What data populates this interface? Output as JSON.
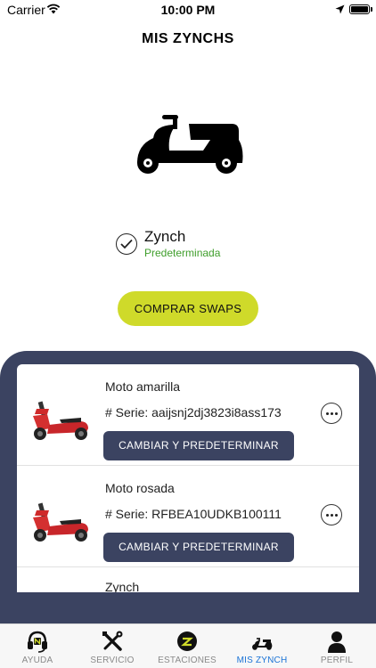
{
  "status_bar": {
    "carrier": "Carrier",
    "time": "10:00 PM"
  },
  "header": {
    "title": "MIS ZYNCHS"
  },
  "selected_vehicle": {
    "name": "Zynch",
    "status": "Predeterminada"
  },
  "buy_button": {
    "label": "COMPRAR SWAPS"
  },
  "vehicles": [
    {
      "name": "Moto amarilla",
      "serial": "# Serie: aaijsnj2dj3823i8ass173",
      "action": "CAMBIAR Y PREDETERMINAR"
    },
    {
      "name": "Moto rosada",
      "serial": "# Serie: RFBEA10UDKB100111",
      "action": "CAMBIAR Y PREDETERMINAR"
    },
    {
      "name": "Zynch"
    }
  ],
  "tabs": [
    {
      "label": "AYUDA",
      "icon": "headset-icon"
    },
    {
      "label": "SERVICIO",
      "icon": "tools-icon"
    },
    {
      "label": "ESTACIONES",
      "icon": "station-icon"
    },
    {
      "label": "MIS ZYNCH",
      "icon": "scooter-icon",
      "active": true
    },
    {
      "label": "PERFIL",
      "icon": "user-icon"
    }
  ],
  "colors": {
    "accent": "#cfda2a",
    "panel": "#3b4361",
    "success": "#3f9e2b",
    "active_tab": "#1a73d6"
  }
}
